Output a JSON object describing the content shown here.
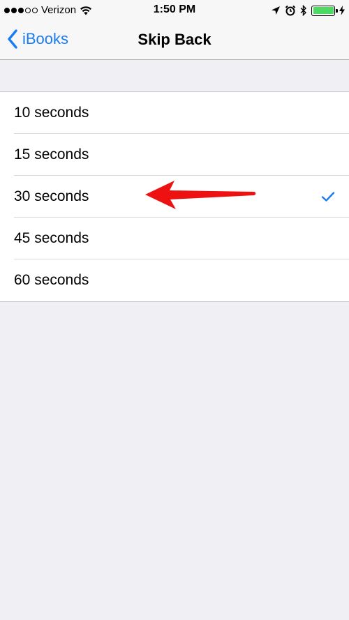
{
  "status_bar": {
    "carrier": "Verizon",
    "time": "1:50 PM"
  },
  "nav": {
    "back_label": "iBooks",
    "title": "Skip Back"
  },
  "options": [
    {
      "label": "10 seconds",
      "selected": false
    },
    {
      "label": "15 seconds",
      "selected": false
    },
    {
      "label": "30 seconds",
      "selected": true
    },
    {
      "label": "45 seconds",
      "selected": false
    },
    {
      "label": "60 seconds",
      "selected": false
    }
  ],
  "colors": {
    "accent": "#1a7bf2",
    "annotation_arrow": "#ee1111",
    "battery": "#4cd964"
  },
  "icons": [
    "wifi-icon",
    "location-arrow-icon",
    "alarm-icon",
    "bluetooth-icon",
    "battery-icon",
    "charging-bolt-icon",
    "chevron-left-icon",
    "checkmark-icon",
    "annotation-arrow-icon"
  ]
}
